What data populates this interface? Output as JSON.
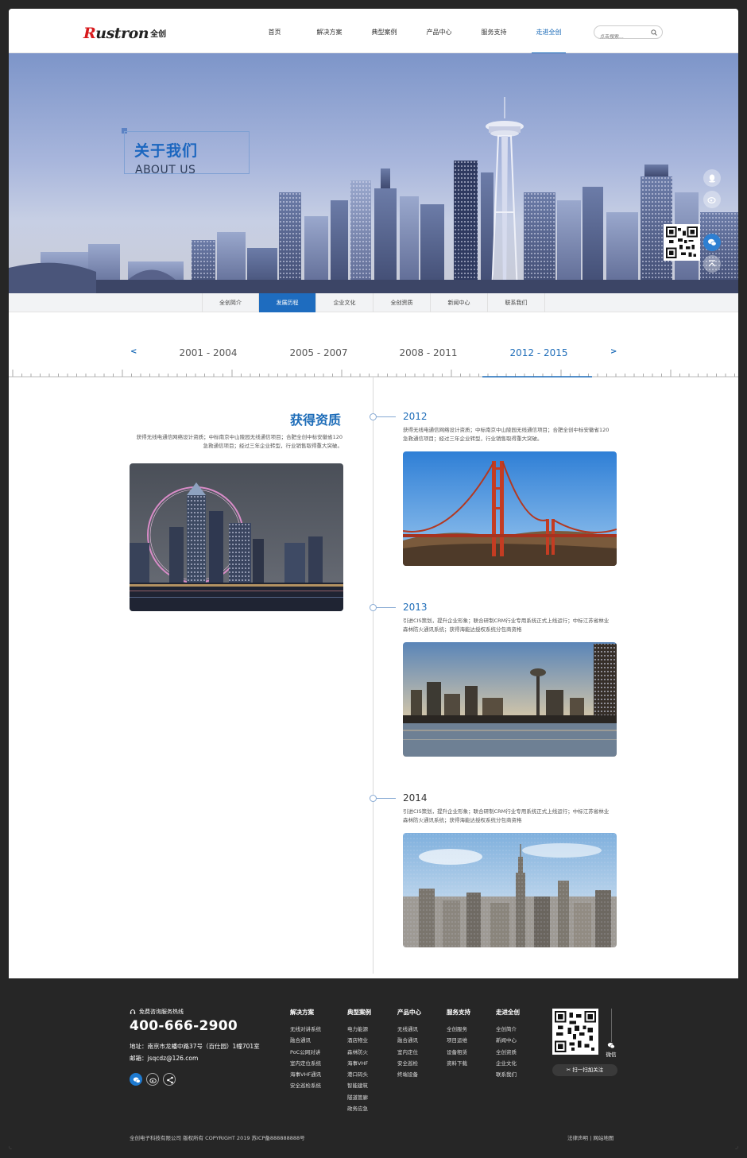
{
  "header": {
    "logo_text": "Rustron",
    "logo_first_letter": "R",
    "logo_rest": "ustron",
    "logo_cn": "全创",
    "nav": [
      "首页",
      "解决方案",
      "典型案例",
      "产品中心",
      "服务支持",
      "走进全创"
    ],
    "active_nav": "走进全创",
    "search_placeholder": "点击搜索..."
  },
  "banner": {
    "title_cn": "关于我们",
    "title_en": "ABOUT US"
  },
  "subnav": {
    "items": [
      "全创简介",
      "发展历程",
      "企业文化",
      "全创资质",
      "新闻中心",
      "联系我们"
    ],
    "active": "发展历程"
  },
  "timeline": {
    "prev_label": "<",
    "next_label": ">",
    "periods": [
      "2001 - 2004",
      "2005 - 2007",
      "2008 - 2011",
      "2012 - 2015"
    ],
    "active_period": "2012 - 2015",
    "left": {
      "title": "获得资质",
      "desc_line1": "获得无线电通信网络设计资质；中标南京中山陵园无线通信项目；合肥全创中标安徽省120",
      "desc_line2": "急救通信项目；经过三年企业转型，行业销售取得重大突破。"
    },
    "events": [
      {
        "year": "2012",
        "desc_line1": "获得无线电通信网络设计资质；中标南京中山陵园无线通信项目；合肥全创中标安徽省120",
        "desc_line2": "急救通信项目；经过三年企业转型，行业销售取得重大突破。"
      },
      {
        "year": "2013",
        "desc_line1": "引进CIS策划，提升企业形象；联合研制CRM行业专用系统正式上线运行；中标江苏省林业",
        "desc_line2": "森林防火通讯系统；获得海能达授权系统分包商资格"
      },
      {
        "year": "2014",
        "desc_line1": "引进CIS策划，提升企业形象；联合研制CRM行业专用系统正式上线运行；中标江苏省林业",
        "desc_line2": "森林防火通讯系统；获得海能达授权系统分包商资格"
      }
    ]
  },
  "footer": {
    "hotline_label": "免费咨询服务热线",
    "phone": "400-666-2900",
    "address": "地址：南京市龙蟠中路37号（百仕园）1幢701室",
    "email": "邮箱：jsqcdz@126.com",
    "columns": [
      {
        "title": "解决方案",
        "links": [
          "无线对讲系统",
          "融合通讯",
          "PoC公网对讲",
          "室内定位系统",
          "海事VHF通讯",
          "安全巡检系统"
        ]
      },
      {
        "title": "典型案例",
        "links": [
          "电力能源",
          "酒店物业",
          "森林防火",
          "海事VHF",
          "港口码头",
          "智能建筑",
          "隧道管廊",
          "政务应急"
        ]
      },
      {
        "title": "产品中心",
        "links": [
          "无线通讯",
          "融合通讯",
          "室内定位",
          "安全巡检",
          "终端设备"
        ]
      },
      {
        "title": "服务支持",
        "links": [
          "全创服务",
          "项目运维",
          "设备租赁",
          "资料下载"
        ]
      },
      {
        "title": "走进全创",
        "links": [
          "全创简介",
          "新闻中心",
          "全创资质",
          "企业文化",
          "联系我们"
        ]
      }
    ],
    "wechat_label": "微信",
    "scan_label": "扫一扫加关注",
    "copyright": "全创电子科技有限公司 版权所有 COPYRIGHT 2019  苏ICP备888888888号",
    "legal": "法律声明  |  网站地图"
  },
  "colors": {
    "brand_blue": "#1d6cb8",
    "logo_red": "#d7191c",
    "footer_bg": "#262626"
  }
}
